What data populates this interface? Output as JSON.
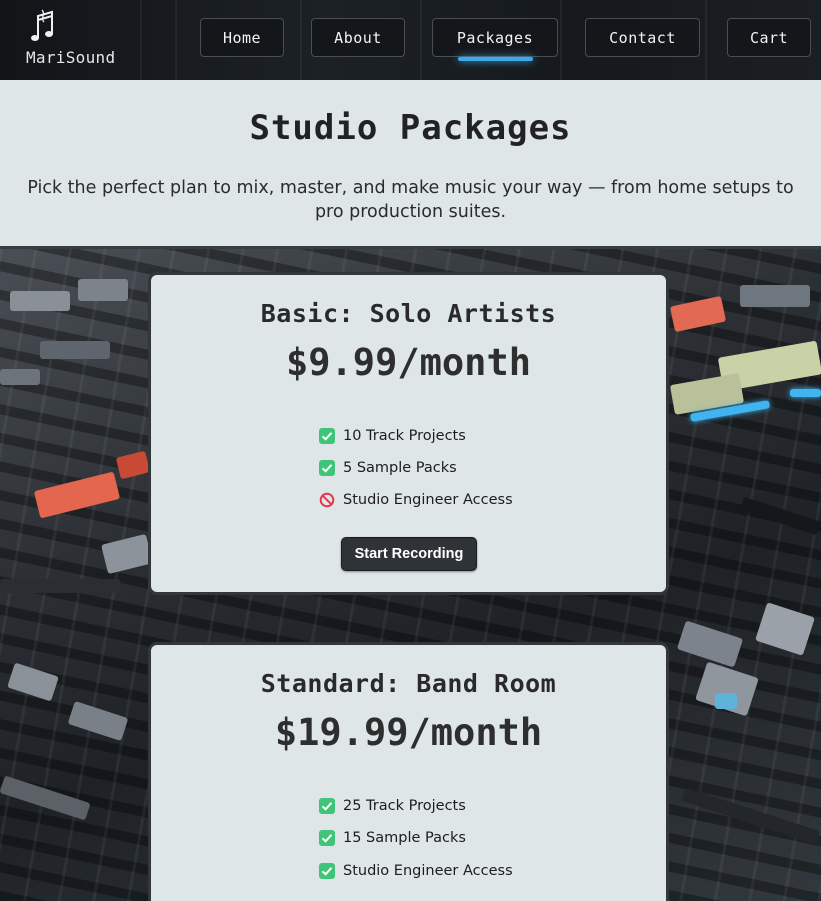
{
  "brand": {
    "name": "MariSound",
    "logo_icon": "music-notes-icon"
  },
  "nav": {
    "items": [
      {
        "label": "Home"
      },
      {
        "label": "About"
      },
      {
        "label": "Packages",
        "active": true
      },
      {
        "label": "Contact"
      },
      {
        "label": "Cart"
      }
    ],
    "active_color": "#3fa9e6"
  },
  "intro": {
    "title": "Studio Packages",
    "subtitle": "Pick the perfect plan to mix, master, and make music your way — from home setups to pro production suites."
  },
  "packages": [
    {
      "title": "Basic: Solo Artists",
      "price": "$9.99/month",
      "features": [
        {
          "label": "10 Track Projects",
          "included": true,
          "icon": "check-box-icon"
        },
        {
          "label": "5 Sample Packs",
          "included": true,
          "icon": "check-box-icon"
        },
        {
          "label": "Studio Engineer Access",
          "included": false,
          "icon": "prohibited-icon"
        }
      ],
      "cta": "Start Recording"
    },
    {
      "title": "Standard: Band Room",
      "price": "$19.99/month",
      "features": [
        {
          "label": "25 Track Projects",
          "included": true,
          "icon": "check-box-icon"
        },
        {
          "label": "15 Sample Packs",
          "included": true,
          "icon": "check-box-icon"
        },
        {
          "label": "Studio Engineer Access",
          "included": true,
          "icon": "check-box-icon"
        }
      ]
    }
  ],
  "colors": {
    "check": "#3fc47a",
    "prohibited": "#e0384f",
    "card_bg": "#dfe6e7",
    "button_bg": "#2f3338"
  }
}
